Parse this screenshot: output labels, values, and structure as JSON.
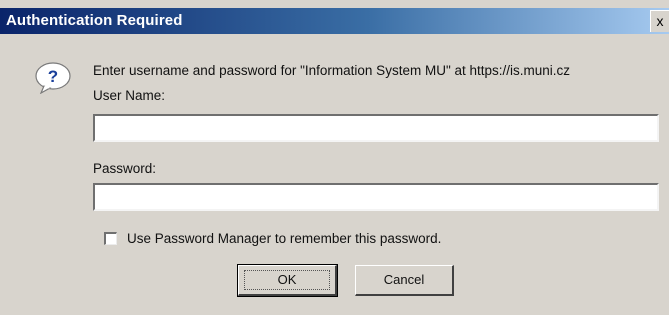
{
  "dialog": {
    "title": "Authentication Required",
    "close_glyph": "x",
    "prompt": "Enter username and password for \"Information System MU\" at https://is.muni.cz",
    "icon": "question-icon",
    "username": {
      "label": "User Name:",
      "value": ""
    },
    "password": {
      "label": "Password:",
      "value": ""
    },
    "remember": {
      "label": "Use Password Manager to remember this password.",
      "checked": false
    },
    "buttons": {
      "ok": "OK",
      "cancel": "Cancel"
    }
  },
  "colors": {
    "titlebar_start": "#0a246a",
    "titlebar_end": "#a6caf0",
    "dialog_bg": "#d8d4cd"
  }
}
